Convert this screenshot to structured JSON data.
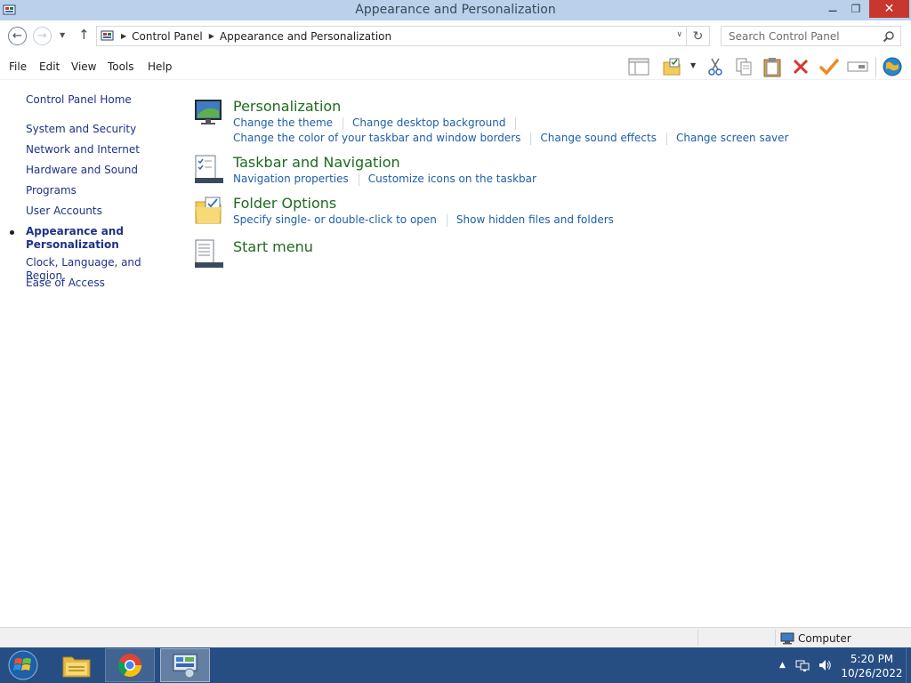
{
  "window": {
    "title": "Appearance and Personalization",
    "close_glyph": "✕",
    "minimize_glyph": "—",
    "maximize_glyph": "❐"
  },
  "address_bar": {
    "breadcrumbs": [
      "Control Panel",
      "Appearance and Personalization"
    ],
    "search_placeholder": "Search Control Panel"
  },
  "menu": {
    "items": [
      "File",
      "Edit",
      "View",
      "Tools",
      "Help"
    ]
  },
  "left_nav": {
    "home": "Control Panel Home",
    "items": [
      "System and Security",
      "Network and Internet",
      "Hardware and Sound",
      "Programs",
      "User Accounts"
    ],
    "current_line1": "Appearance and",
    "current_line2": "Personalization",
    "items_after": [
      "Clock, Language, and Region",
      "Ease of Access"
    ]
  },
  "categories": [
    {
      "title": "Personalization",
      "icon": "personalization-icon",
      "rows": [
        [
          "Change the theme",
          "Change desktop background"
        ],
        [
          "Change the color of your taskbar and window borders",
          "Change sound effects",
          "Change screen saver"
        ]
      ]
    },
    {
      "title": "Taskbar and Navigation",
      "icon": "taskbar-navigation-icon",
      "rows": [
        [
          "Navigation properties",
          "Customize icons on the taskbar"
        ]
      ]
    },
    {
      "title": "Folder Options",
      "icon": "folder-options-icon",
      "rows": [
        [
          "Specify single- or double-click to open",
          "Show hidden files and folders"
        ]
      ]
    },
    {
      "title": "Start menu",
      "icon": "start-menu-icon",
      "rows": []
    }
  ],
  "status_bar": {
    "location": "Computer"
  },
  "taskbar": {
    "time": "5:20 PM",
    "date": "10/26/2022"
  },
  "colors": {
    "titlebar": "#b9d1ea",
    "close_button": "#c7372f",
    "category_title": "#1e6a1f",
    "task_link": "#1f5ea8",
    "nav_link": "#1e3287",
    "taskbar": "#274e82"
  }
}
